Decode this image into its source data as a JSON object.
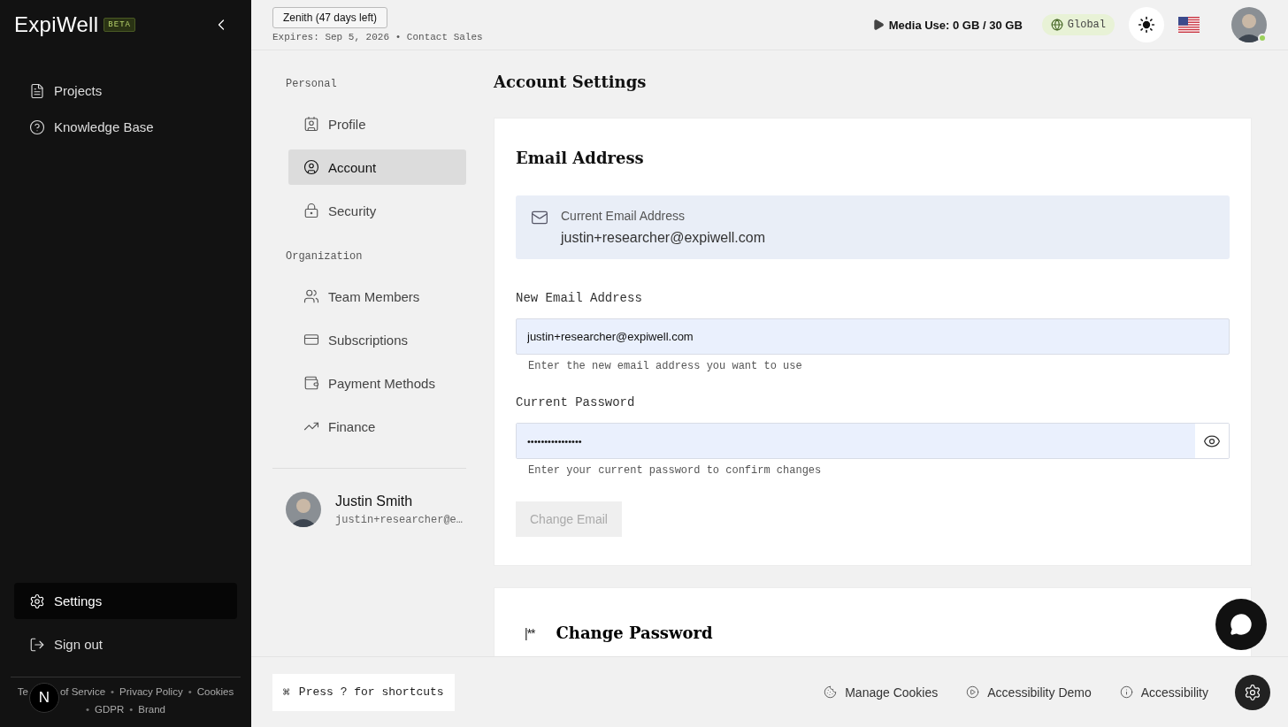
{
  "sidebar": {
    "logo": "ExpiWell",
    "logo_badge": "BETA",
    "items": [
      {
        "label": "Projects",
        "selected": false
      },
      {
        "label": "Knowledge Base",
        "selected": false
      }
    ],
    "bottom_items": [
      {
        "label": "Settings",
        "selected": true
      },
      {
        "label": "Sign out",
        "selected": false
      }
    ],
    "footer_link_partial": {
      "start": "Te",
      "end": "of Service"
    },
    "footer_links": [
      "Privacy Policy",
      "Cookies",
      "GDPR",
      "Brand"
    ],
    "separator": "•",
    "dev_badge": "N"
  },
  "topbar": {
    "plan": "Zenith (47 days left)",
    "expires": "Expires: Sep 5, 2026",
    "expires_separator": "•",
    "contact": "Contact Sales",
    "media": "Media Use: 0 GB / 30 GB",
    "region": "Global"
  },
  "settings_nav": {
    "sections": [
      {
        "title": "Personal",
        "items": [
          {
            "label": "Profile",
            "selected": false
          },
          {
            "label": "Account",
            "selected": true
          },
          {
            "label": "Security",
            "selected": false
          }
        ]
      },
      {
        "title": "Organization",
        "items": [
          {
            "label": "Team Members",
            "selected": false
          },
          {
            "label": "Subscriptions",
            "selected": false
          },
          {
            "label": "Payment Methods",
            "selected": false
          },
          {
            "label": "Finance",
            "selected": false
          }
        ]
      }
    ],
    "user": {
      "name": "Justin Smith",
      "email": "justin+researcher@e…"
    }
  },
  "page_title": "Account Settings",
  "email_card": {
    "title": "Email Address",
    "current_label": "Current Email Address",
    "current_value": "justin+researcher@expiwell.com",
    "new_label": "New Email Address",
    "new_value": "justin+researcher@expiwell.com",
    "new_hint": "Enter the new email address you want to use",
    "password_label": "Current Password",
    "password_value": "••••••••••••••••",
    "password_hint": "Enter your current password to confirm changes",
    "button": {
      "label": "Change Email",
      "disabled": true
    }
  },
  "password_card": {
    "icon_text": "|**",
    "title": "Change Password"
  },
  "footer": {
    "shortcut_key": "⌘",
    "shortcut": "Press ? for shortcuts",
    "links": [
      "Manage Cookies",
      "Accessibility Demo",
      "Accessibility"
    ]
  }
}
